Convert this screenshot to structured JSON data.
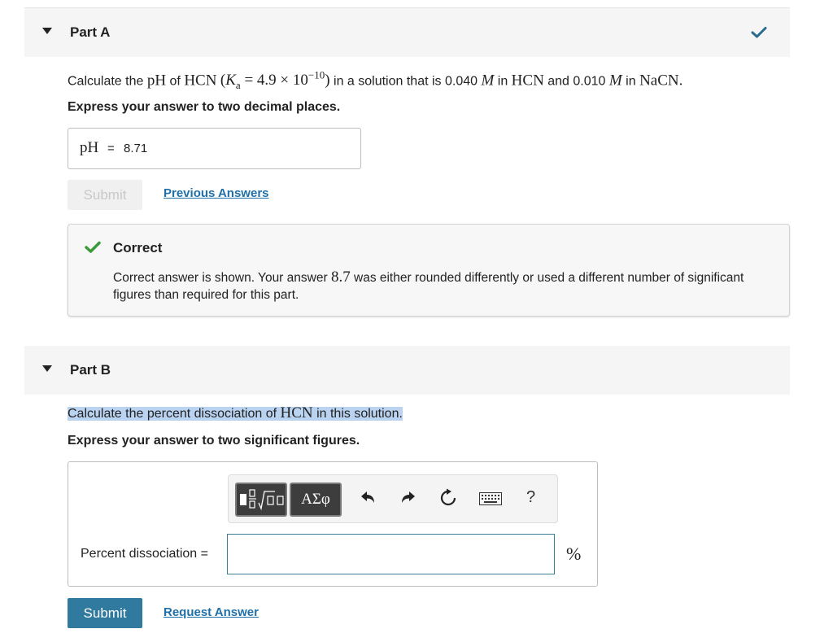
{
  "colors": {
    "accent": "#2f7a9e",
    "link": "#1f6fa8",
    "correct": "#3a9a3a",
    "highlight": "#b9d3f1"
  },
  "part_a": {
    "title": "Part A",
    "status_icon": "check-icon",
    "prompt": {
      "lead": "Calculate the",
      "ph": "pH",
      "of": "of",
      "hcn": "HCN",
      "ka_open": "(",
      "ka_sym": "K",
      "ka_sub": "a",
      "ka_eq": "= 4.9 × 10",
      "ka_exp": "−10",
      "ka_close": ")",
      "mid": "in a solution that is 0.040",
      "M1": "M",
      "in1": "in",
      "hcn2": "HCN",
      "and": "and 0.010",
      "M2": "M",
      "in2": "in",
      "nacn": "NaCN",
      "end": "."
    },
    "instruction": "Express your answer to two decimal places.",
    "answer_label": "pH",
    "answer_equals": "=",
    "answer_value": "8.71",
    "submit_label": "Submit",
    "previous_answers_label": "Previous Answers",
    "feedback": {
      "title": "Correct",
      "text_before": "Correct answer is shown. Your answer",
      "your_answer": "8.7",
      "text_after": "was either rounded differently or used a different number of significant figures than required for this part."
    }
  },
  "part_b": {
    "title": "Part B",
    "prompt_before": "Calculate the percent dissociation of",
    "prompt_math": "HCN",
    "prompt_after": "in this solution.",
    "instruction": "Express your answer to two significant figures.",
    "toolbar": {
      "greek_label": "ΑΣφ",
      "help_label": "?"
    },
    "field_label": "Percent dissociation =",
    "field_value": "",
    "unit": "%",
    "submit_label": "Submit",
    "request_answer_label": "Request Answer"
  }
}
